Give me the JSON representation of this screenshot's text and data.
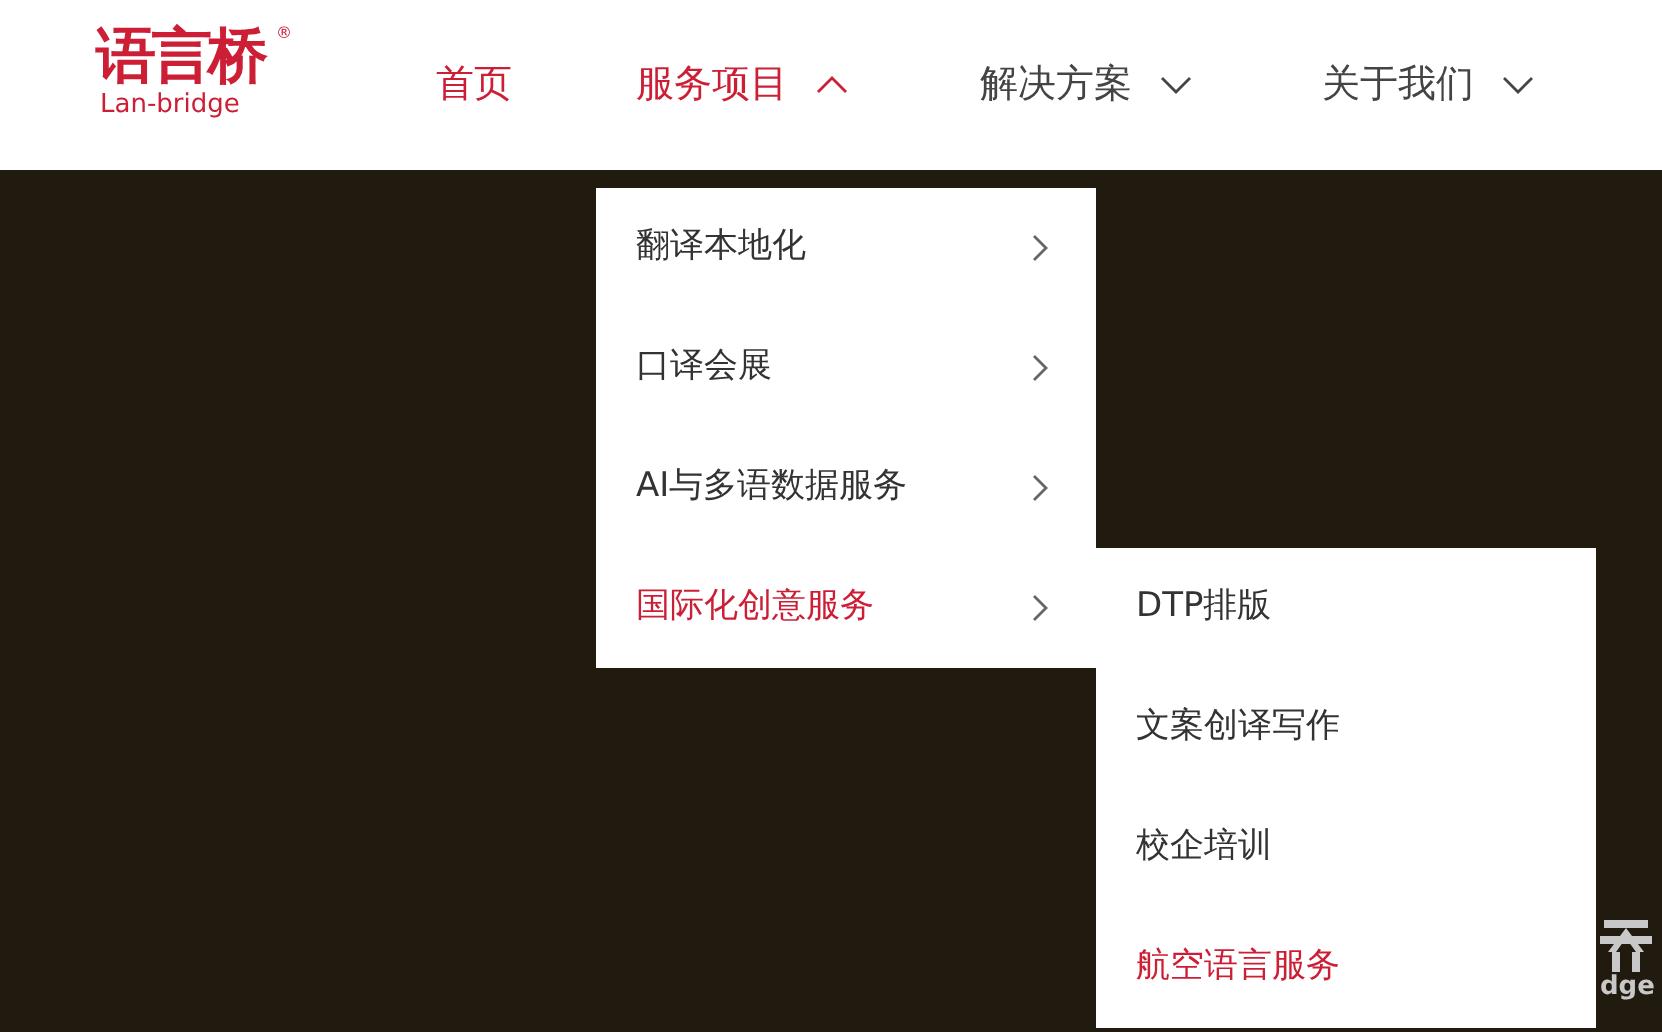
{
  "logo": {
    "name": "语言桥",
    "subtitle": "Lan-bridge",
    "mark": "®"
  },
  "nav": [
    {
      "label": "首页",
      "kind": "link",
      "selected": true
    },
    {
      "label": "服务项目",
      "kind": "dropdown",
      "expanded": true
    },
    {
      "label": "解决方案",
      "kind": "dropdown",
      "expanded": false
    },
    {
      "label": "关于我们",
      "kind": "dropdown",
      "expanded": false
    }
  ],
  "menu": {
    "items": [
      {
        "label": "翻译本地化",
        "selected": false
      },
      {
        "label": "口译会展",
        "selected": false
      },
      {
        "label": "AI与多语数据服务",
        "selected": false
      },
      {
        "label": "国际化创意服务",
        "selected": true
      }
    ],
    "submenu": [
      {
        "label": "DTP排版",
        "selected": false
      },
      {
        "label": "文案创译写作",
        "selected": false
      },
      {
        "label": "校企培训",
        "selected": false
      },
      {
        "label": "航空语言服务",
        "selected": true
      }
    ]
  },
  "banner": {
    "logo_text": "dge"
  }
}
